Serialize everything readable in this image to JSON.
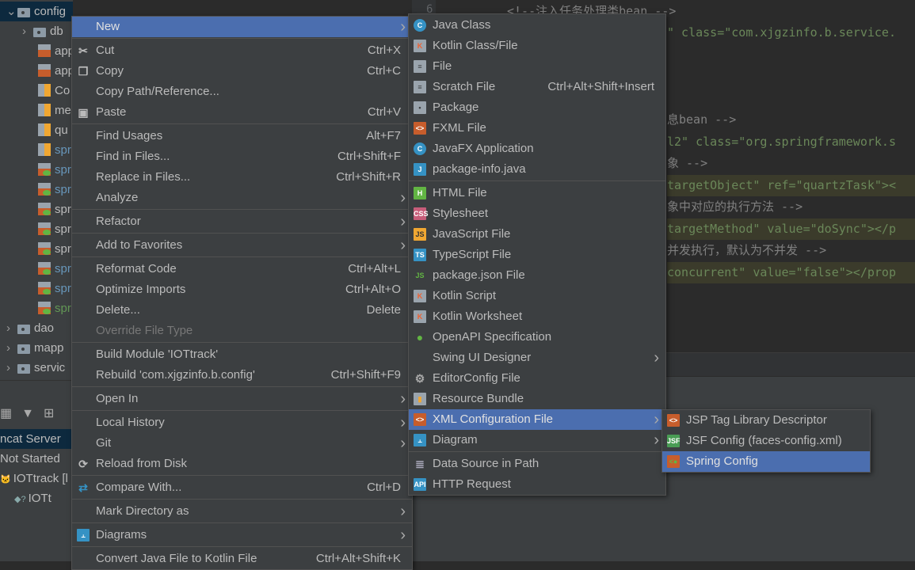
{
  "project_tree": {
    "items": [
      {
        "label": "config",
        "icon": "folder-icon",
        "expanded": true,
        "selected": true,
        "level": 0
      },
      {
        "label": "db",
        "icon": "folder-icon",
        "expanded": false,
        "level": 1
      },
      {
        "label": "app",
        "icon": "xml-file-icon",
        "level": 2
      },
      {
        "label": "app",
        "icon": "xml-file-icon",
        "level": 2
      },
      {
        "label": "Co",
        "icon": "properties-file-icon",
        "level": 2
      },
      {
        "label": "me",
        "icon": "properties-file-icon",
        "level": 2
      },
      {
        "label": "qu",
        "icon": "properties-file-icon",
        "level": 2
      },
      {
        "label": "spr",
        "icon": "properties-file-icon",
        "level": 2,
        "color": "#6897bb"
      },
      {
        "label": "spr",
        "icon": "spring-xml-icon",
        "level": 2,
        "color": "#6897bb"
      },
      {
        "label": "spr",
        "icon": "spring-xml-icon",
        "level": 2,
        "color": "#6897bb"
      },
      {
        "label": "spr",
        "icon": "spring-xml-icon",
        "level": 2
      },
      {
        "label": "spr",
        "icon": "spring-xml-icon",
        "level": 2
      },
      {
        "label": "spr",
        "icon": "spring-xml-icon",
        "level": 2
      },
      {
        "label": "spr",
        "icon": "spring-xml-icon",
        "level": 2,
        "color": "#6897bb"
      },
      {
        "label": "spr",
        "icon": "spring-xml-icon",
        "level": 2,
        "color": "#6897bb"
      },
      {
        "label": "spr",
        "icon": "spring-xml-icon",
        "level": 2,
        "color": "#629755"
      },
      {
        "label": "dao",
        "icon": "folder-icon",
        "expanded": false,
        "level": 0
      },
      {
        "label": "mapp",
        "icon": "folder-icon",
        "expanded": false,
        "level": 0
      },
      {
        "label": "servic",
        "icon": "folder-icon",
        "expanded": false,
        "level": 0
      }
    ]
  },
  "services": {
    "rows": [
      {
        "label": "ncat Server",
        "selected": true
      },
      {
        "label": "Not Started"
      },
      {
        "label": "IOTtrack [l",
        "icon": "tomcat-icon"
      },
      {
        "label": "IOTt",
        "icon": "artifact-unknown-icon"
      }
    ]
  },
  "editor": {
    "line_number": "6",
    "lines": [
      {
        "text": "<!--注入任务处理类bean  -->",
        "hl": false
      },
      {
        "text": "\" class=\"com.xjgzinfo.b.service.",
        "hl": false
      },
      {
        "text": "息bean -->",
        "hl": false
      },
      {
        "text": "l2\" class=\"org.springframework.s",
        "hl": false
      },
      {
        "text": "象 -->",
        "hl": false
      },
      {
        "text": "targetObject\" ref=\"quartzTask\"><",
        "hl": true
      },
      {
        "text": "象中对应的执行方法 -->",
        "hl": false
      },
      {
        "text": "targetMethod\" value=\"doSync\"></p",
        "hl": true
      },
      {
        "text": "并发执行，默认为不并发 -->",
        "hl": false
      },
      {
        "text": "concurrent\" value=\"false\"></prop",
        "hl": true
      }
    ]
  },
  "context_menu": {
    "items": [
      {
        "label": "New",
        "submenu": true,
        "highlighted": true
      },
      {
        "sep": true
      },
      {
        "label": "Cut",
        "shortcut": "Ctrl+X",
        "icon": "scissors-icon"
      },
      {
        "label": "Copy",
        "shortcut": "Ctrl+C",
        "icon": "copy-icon"
      },
      {
        "label": "Copy Path/Reference..."
      },
      {
        "label": "Paste",
        "shortcut": "Ctrl+V",
        "icon": "clipboard-icon"
      },
      {
        "sep": true
      },
      {
        "label": "Find Usages",
        "shortcut": "Alt+F7"
      },
      {
        "label": "Find in Files...",
        "shortcut": "Ctrl+Shift+F"
      },
      {
        "label": "Replace in Files...",
        "shortcut": "Ctrl+Shift+R"
      },
      {
        "label": "Analyze",
        "submenu": true
      },
      {
        "sep": true
      },
      {
        "label": "Refactor",
        "submenu": true
      },
      {
        "sep": true
      },
      {
        "label": "Add to Favorites",
        "submenu": true
      },
      {
        "sep": true
      },
      {
        "label": "Reformat Code",
        "shortcut": "Ctrl+Alt+L"
      },
      {
        "label": "Optimize Imports",
        "shortcut": "Ctrl+Alt+O"
      },
      {
        "label": "Delete...",
        "shortcut": "Delete"
      },
      {
        "label": "Override File Type",
        "disabled": true
      },
      {
        "sep": true
      },
      {
        "label": "Build Module 'IOTtrack'"
      },
      {
        "label": "Rebuild 'com.xjgzinfo.b.config'",
        "shortcut": "Ctrl+Shift+F9"
      },
      {
        "sep": true
      },
      {
        "label": "Open In",
        "submenu": true
      },
      {
        "sep": true
      },
      {
        "label": "Local History",
        "submenu": true
      },
      {
        "label": "Git",
        "submenu": true
      },
      {
        "label": "Reload from Disk",
        "icon": "reload-icon"
      },
      {
        "sep": true
      },
      {
        "label": "Compare With...",
        "shortcut": "Ctrl+D",
        "icon": "compare-icon"
      },
      {
        "sep": true
      },
      {
        "label": "Mark Directory as",
        "submenu": true
      },
      {
        "sep": true
      },
      {
        "label": "Diagrams",
        "submenu": true,
        "icon": "diagram-icon"
      },
      {
        "sep": true
      },
      {
        "label": "Convert Java File to Kotlin File",
        "shortcut": "Ctrl+Alt+Shift+K"
      }
    ]
  },
  "new_submenu": {
    "items": [
      {
        "label": "Java Class",
        "icon": "java-class-icon"
      },
      {
        "label": "Kotlin Class/File",
        "icon": "kotlin-file-icon"
      },
      {
        "label": "File",
        "icon": "file-icon"
      },
      {
        "label": "Scratch File",
        "shortcut": "Ctrl+Alt+Shift+Insert",
        "icon": "scratch-file-icon"
      },
      {
        "label": "Package",
        "icon": "package-icon"
      },
      {
        "label": "FXML File",
        "icon": "fxml-file-icon"
      },
      {
        "label": "JavaFX Application",
        "icon": "java-class-icon"
      },
      {
        "label": "package-info.java",
        "icon": "java-file-icon"
      },
      {
        "sep": true
      },
      {
        "label": "HTML File",
        "icon": "html-file-icon"
      },
      {
        "label": "Stylesheet",
        "icon": "css-file-icon"
      },
      {
        "label": "JavaScript File",
        "icon": "js-file-icon"
      },
      {
        "label": "TypeScript File",
        "icon": "ts-file-icon"
      },
      {
        "label": "package.json File",
        "icon": "nodejs-icon"
      },
      {
        "label": "Kotlin Script",
        "icon": "kotlin-file-icon"
      },
      {
        "label": "Kotlin Worksheet",
        "icon": "kotlin-file-icon"
      },
      {
        "label": "OpenAPI Specification",
        "icon": "openapi-icon"
      },
      {
        "label": "Swing UI Designer",
        "submenu": true
      },
      {
        "label": "EditorConfig File",
        "icon": "gear-icon"
      },
      {
        "label": "Resource Bundle",
        "icon": "properties-file-icon"
      },
      {
        "label": "XML Configuration File",
        "icon": "xml-file-icon",
        "submenu": true,
        "highlighted": true
      },
      {
        "label": "Diagram",
        "icon": "diagram-icon",
        "submenu": true
      },
      {
        "sep": true
      },
      {
        "label": "Data Source in Path",
        "icon": "database-icon"
      },
      {
        "label": "HTTP Request",
        "icon": "api-icon"
      }
    ]
  },
  "xml_submenu": {
    "items": [
      {
        "label": "JSP Tag Library Descriptor",
        "icon": "xml-file-icon"
      },
      {
        "label": "JSF Config (faces-config.xml)",
        "icon": "jsf-file-icon"
      },
      {
        "label": "Spring Config",
        "icon": "spring-xml-icon",
        "highlighted": true
      }
    ]
  },
  "colors": {
    "menu_bg": "#3c3f41",
    "highlight": "#4b6eaf",
    "tree_selected": "#0d293e",
    "editor_bg": "#2b2b2b"
  }
}
